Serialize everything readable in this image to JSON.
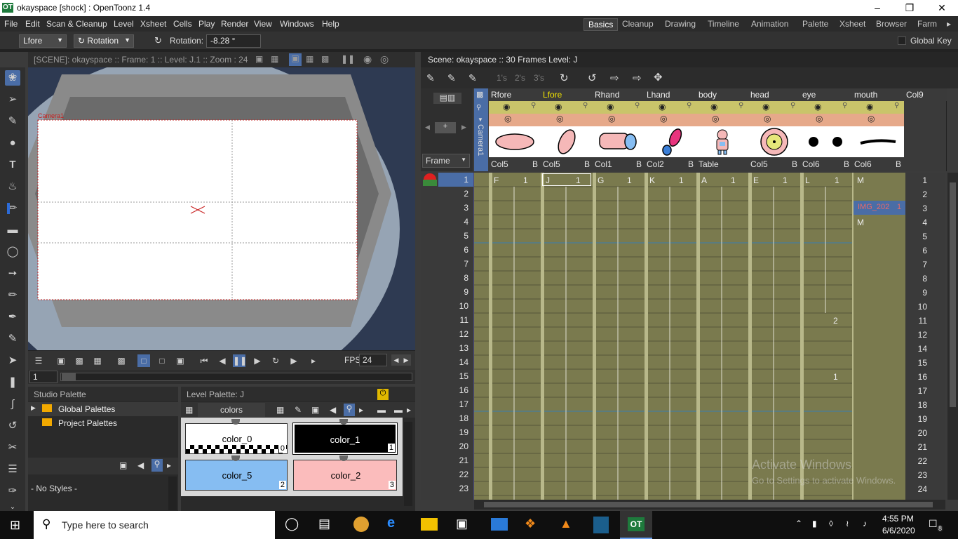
{
  "window": {
    "title": "okayspace [shock] : OpenToonz 1.4",
    "app_icon": "OT"
  },
  "menu": [
    "File",
    "Edit",
    "Scan & Cleanup",
    "Level",
    "Xsheet",
    "Cells",
    "Play",
    "Render",
    "View",
    "Windows",
    "Help"
  ],
  "rooms": [
    "Basics",
    "Cleanup",
    "Drawing",
    "Timeline",
    "Animation",
    "Palette",
    "Xsheet",
    "Browser",
    "Farm"
  ],
  "active_room": "Basics",
  "tool_options": {
    "target": "Lfore",
    "mode": "Rotation",
    "rotation_label": "Rotation:",
    "rotation_value": "-8.28 °",
    "global_key": "Global Key"
  },
  "viewer": {
    "header": "[SCENE]: okayspace  ::  Frame: 1  ::  Level: J.1  ::  Zoom : 24",
    "camera_label": "Camera1"
  },
  "playback": {
    "fps_label": "FPS",
    "fps_value": "24",
    "frame_value": "1"
  },
  "studio_palette": {
    "title": "Studio Palette",
    "items": [
      "Global Palettes",
      "Project Palettes"
    ],
    "no_styles": "- No Styles -"
  },
  "level_palette": {
    "title": "Level Palette: J",
    "page": "colors",
    "chips": [
      {
        "name": "color_0",
        "index": "0",
        "color": "#ffffff",
        "text": "#000000"
      },
      {
        "name": "color_1",
        "index": "1",
        "color": "#000000",
        "text": "#ffffff"
      },
      {
        "name": "color_5",
        "index": "2",
        "color": "#86bdf2",
        "text": "#000000"
      },
      {
        "name": "color_2",
        "index": "3",
        "color": "#fbbcbc",
        "text": "#000000"
      }
    ]
  },
  "xsheet": {
    "scene_label": "Scene: okayspace  ::  30 Frames  Level: J",
    "step_buttons": [
      "1's",
      "2's",
      "3's"
    ],
    "camera_col": "Camera1",
    "frame_combo": "Frame",
    "columns": [
      {
        "name": "Rfore",
        "foot": "Col5",
        "level": "F"
      },
      {
        "name": "Lfore",
        "foot": "Col5",
        "level": "J"
      },
      {
        "name": "Rhand",
        "foot": "Col1",
        "level": "G"
      },
      {
        "name": "Lhand",
        "foot": "Col2",
        "level": "K"
      },
      {
        "name": "body",
        "foot": "Table",
        "level": "A"
      },
      {
        "name": "head",
        "foot": "Col5",
        "level": "E"
      },
      {
        "name": "eye",
        "foot": "Col6",
        "level": "L"
      },
      {
        "name": "mouth",
        "foot": "Col6",
        "level": "M"
      }
    ],
    "extra_col": "Col9",
    "col_letter": "B",
    "rows": [
      "1",
      "2",
      "3",
      "4",
      "5",
      "6",
      "7",
      "8",
      "9",
      "10",
      "11",
      "12",
      "13",
      "14",
      "15",
      "16",
      "17",
      "18",
      "19",
      "20",
      "21",
      "22",
      "23"
    ],
    "right_nums": [
      "1",
      "2",
      "3",
      "4",
      "5",
      "6",
      "7",
      "8",
      "9",
      "10",
      "11",
      "12",
      "14",
      "15",
      "16",
      "17",
      "18",
      "19",
      "20",
      "21",
      "22",
      "23",
      "24"
    ],
    "cells_frame1": "1",
    "eye_row11": "2",
    "eye_row15": "1",
    "mouth_row1": "M",
    "mouth_row3": "IMG_202",
    "mouth_row3_frame": "1",
    "mouth_row4": "M"
  },
  "watermark": {
    "line1": "Activate Windows",
    "line2": "Go to Settings to activate Windows."
  },
  "taskbar": {
    "search_placeholder": "Type here to search",
    "time": "4:55 PM",
    "date": "6/6/2020",
    "notif": "8"
  }
}
